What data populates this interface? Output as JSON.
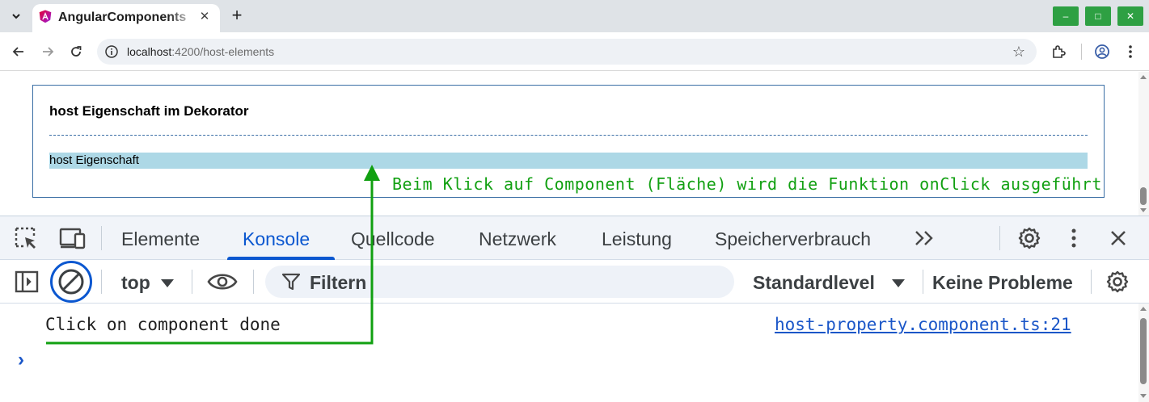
{
  "browser": {
    "tab": {
      "title": "AngularComponents"
    },
    "window_controls": {
      "minimize": "–",
      "maximize": "□",
      "close": "✕"
    },
    "address": {
      "host": "localhost",
      "rest": ":4200/host-elements"
    }
  },
  "page": {
    "heading": "host Eigenschaft im Dekorator",
    "host_text": "host Eigenschaft",
    "annotation": "Beim Klick auf Component (Fläche) wird die Funktion onClick ausgeführt"
  },
  "devtools": {
    "tabs": [
      "Elemente",
      "Konsole",
      "Quellcode",
      "Netzwerk",
      "Leistung",
      "Speicherverbrauch"
    ],
    "active_tab": "Konsole",
    "context": "top",
    "filter_placeholder": "Filtern",
    "level": "Standardlevel",
    "issues": "Keine Probleme",
    "console": {
      "message": "Click on component done",
      "source": "host-property.component.ts:21",
      "prompt": "›"
    }
  },
  "colors": {
    "annotation": "#11a011",
    "host_background": "#add8e6",
    "accent": "#0b57d0",
    "window_buttons": "#2ea043"
  },
  "icons": [
    "tab-search-icon",
    "angular-icon",
    "back-icon",
    "forward-icon",
    "reload-icon",
    "site-info-icon",
    "star-icon",
    "extensions-icon",
    "profile-icon",
    "menu-icon",
    "inspect-icon",
    "device-toolbar-icon",
    "settings-icon",
    "more-icon",
    "close-icon",
    "sidebar-icon",
    "clear-console-icon",
    "eye-icon",
    "filter-icon",
    "chevron-down-icon"
  ]
}
